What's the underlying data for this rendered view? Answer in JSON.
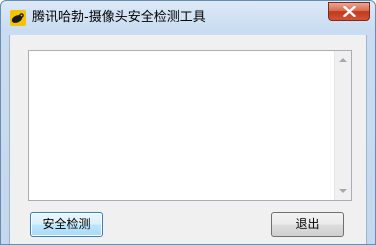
{
  "window": {
    "title": "腾讯哈勃-摄像头安全检测工具",
    "icon": "webcam-app-icon",
    "close_icon": "close-icon"
  },
  "output": {
    "text": ""
  },
  "buttons": {
    "scan_label": "安全检测",
    "exit_label": "退出"
  },
  "colors": {
    "close_button": "#c1391a",
    "title_bar": "#c9dcf1",
    "focused_button_border": "#3c7fb1"
  }
}
